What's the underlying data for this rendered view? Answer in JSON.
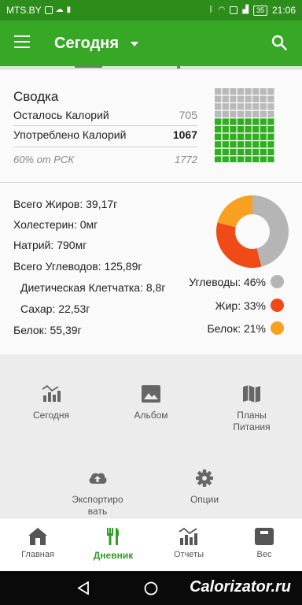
{
  "status_bar": {
    "carrier": "MTS.BY",
    "battery": "35",
    "time": "21:06"
  },
  "app_bar": {
    "title": "Сегодня"
  },
  "summary": {
    "title": "Сводка",
    "remaining_label": "Осталось Калорий",
    "remaining_value": "705",
    "consumed_label": "Употреблено Калорий",
    "consumed_value": "1067",
    "percent_label": "60% от РСК",
    "percent_value": "1772"
  },
  "calorie_grid": {
    "filled_fraction": 0.6,
    "filled_color": "#2fae1f",
    "empty_color": "#b9b9b9"
  },
  "nutrients": {
    "fat": "Всего Жиров: 39,17г",
    "cholesterol": "Холестерин: 0мг",
    "sodium": "Натрий: 790мг",
    "carbs": "Всего Углеводов: 125,89г",
    "fiber": "Диетическая Клетчатка: 8,8г",
    "sugar": "Сахар: 22,53г",
    "protein": "Белок: 55,39г"
  },
  "macros": {
    "carbs_label": "Углеводы: 46%",
    "fat_label": "Жир: 33%",
    "protein_label": "Белок: 21%",
    "carbs_pct": 46,
    "fat_pct": 33,
    "protein_pct": 21,
    "carbs_color": "#b5b5b5",
    "fat_color": "#f04a16",
    "protein_color": "#f8a020"
  },
  "quick_actions": {
    "today": "Сегодня",
    "album": "Альбом",
    "meal_plans": "Планы Питания",
    "export": "Экспортиро вать",
    "options": "Опции"
  },
  "bottom_nav": {
    "home": "Главная",
    "diary": "Дневник",
    "reports": "Отчеты",
    "weight": "Вес"
  },
  "watermark": "Calorizator.ru",
  "accent_color": "#37a825"
}
